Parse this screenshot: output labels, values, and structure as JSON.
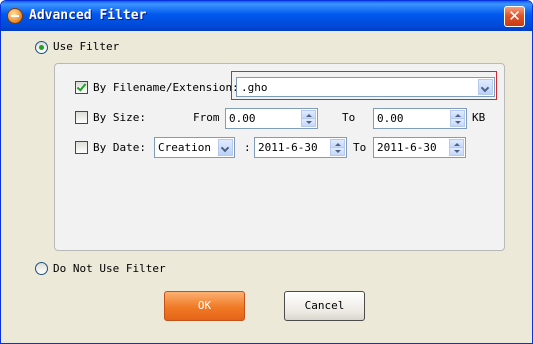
{
  "window": {
    "title": "Advanced Filter",
    "close_label": "✕"
  },
  "use_filter": {
    "label": "Use Filter",
    "selected": true
  },
  "filename": {
    "label": "By Filename/Extension:",
    "checked": true,
    "value": ".gho"
  },
  "size": {
    "label": "By Size:",
    "checked": false,
    "from_label": "From",
    "from_value": "0.00",
    "to_label": "To",
    "to_value": "0.00",
    "unit": "KB"
  },
  "date": {
    "label": "By Date:",
    "checked": false,
    "type_value": "Creation",
    "colon": ":",
    "from_value": "2011-6-30",
    "to_label": "To",
    "to_value": "2011-6-30"
  },
  "no_filter": {
    "label": "Do Not Use Filter",
    "selected": false
  },
  "buttons": {
    "ok": "OK",
    "cancel": "Cancel"
  }
}
